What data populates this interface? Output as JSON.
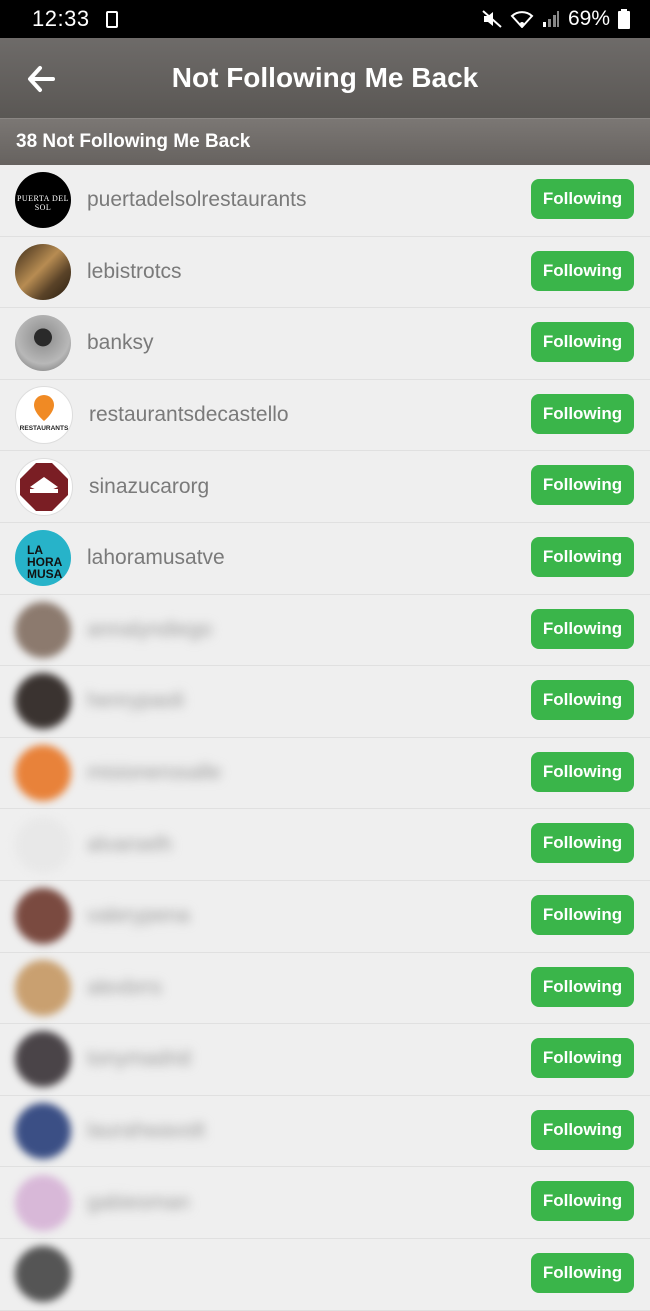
{
  "status_bar": {
    "time": "12:33",
    "battery": "69%"
  },
  "header": {
    "title": "Not Following Me Back"
  },
  "subheader": {
    "count_label": "38 Not Following Me Back"
  },
  "button_label": "Following",
  "rows": [
    {
      "username": "puertadelsolrestaurants",
      "avatar_text": "PUERTA DEL SOL",
      "avatar_color": "#000000",
      "blurred": false
    },
    {
      "username": "lebistrotcs",
      "avatar_text": "",
      "avatar_color": "#6b5233",
      "blurred": false
    },
    {
      "username": "banksy",
      "avatar_text": "",
      "avatar_color": "#8a8a8a",
      "blurred": false
    },
    {
      "username": "restaurantsdecastello",
      "avatar_text": "RESTAURANTS",
      "avatar_color": "#ffffff",
      "blurred": false
    },
    {
      "username": "sinazucarorg",
      "avatar_text": "",
      "avatar_color": "#ffffff",
      "blurred": false
    },
    {
      "username": "lahoramusatve",
      "avatar_text": "LA HORA MUSA",
      "avatar_color": "#27b3c9",
      "blurred": false
    },
    {
      "username": "annalyndiego",
      "avatar_text": "",
      "avatar_color": "#8c7a6e",
      "blurred": true
    },
    {
      "username": "henrypaoli",
      "avatar_text": "",
      "avatar_color": "#3a3330",
      "blurred": true
    },
    {
      "username": "misionerosalle",
      "avatar_text": "",
      "avatar_color": "#e8823a",
      "blurred": true
    },
    {
      "username": "alvaroelh",
      "avatar_text": "",
      "avatar_color": "#e8e8e8",
      "blurred": true
    },
    {
      "username": "valerypena",
      "avatar_text": "",
      "avatar_color": "#7a4a40",
      "blurred": true
    },
    {
      "username": "alexbrrs",
      "avatar_text": "",
      "avatar_color": "#c9a070",
      "blurred": true
    },
    {
      "username": "tonymadrid",
      "avatar_text": "",
      "avatar_color": "#4a4448",
      "blurred": true
    },
    {
      "username": "laurahwavolt",
      "avatar_text": "",
      "avatar_color": "#3b4f85",
      "blurred": true
    },
    {
      "username": "gabiesman",
      "avatar_text": "",
      "avatar_color": "#d8b8d8",
      "blurred": true
    },
    {
      "username": "",
      "avatar_text": "",
      "avatar_color": "#555555",
      "blurred": true
    }
  ]
}
